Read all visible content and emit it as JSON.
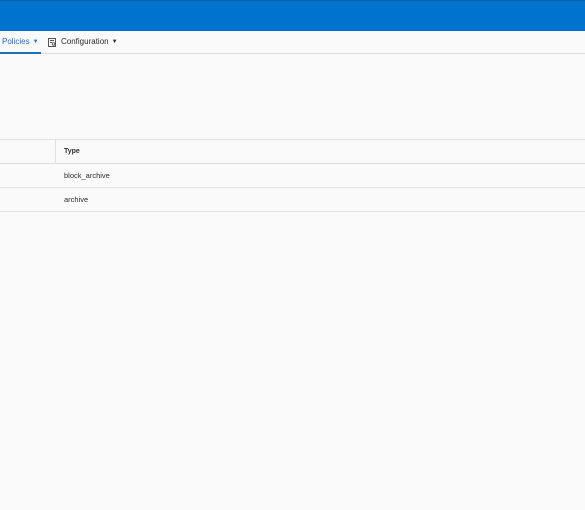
{
  "colors": {
    "topbar": "#0073cf",
    "active_nav": "#1f6fbf"
  },
  "subnav": {
    "items": [
      {
        "label": "Policies",
        "icon": "",
        "has_caret": true,
        "active": true
      },
      {
        "label": "Configuration",
        "icon": "configuration-icon",
        "has_caret": true,
        "active": false
      }
    ]
  },
  "table": {
    "columns": [
      "",
      "Type"
    ],
    "rows": [
      {
        "type": "block_archive"
      },
      {
        "type": "archive"
      }
    ]
  }
}
